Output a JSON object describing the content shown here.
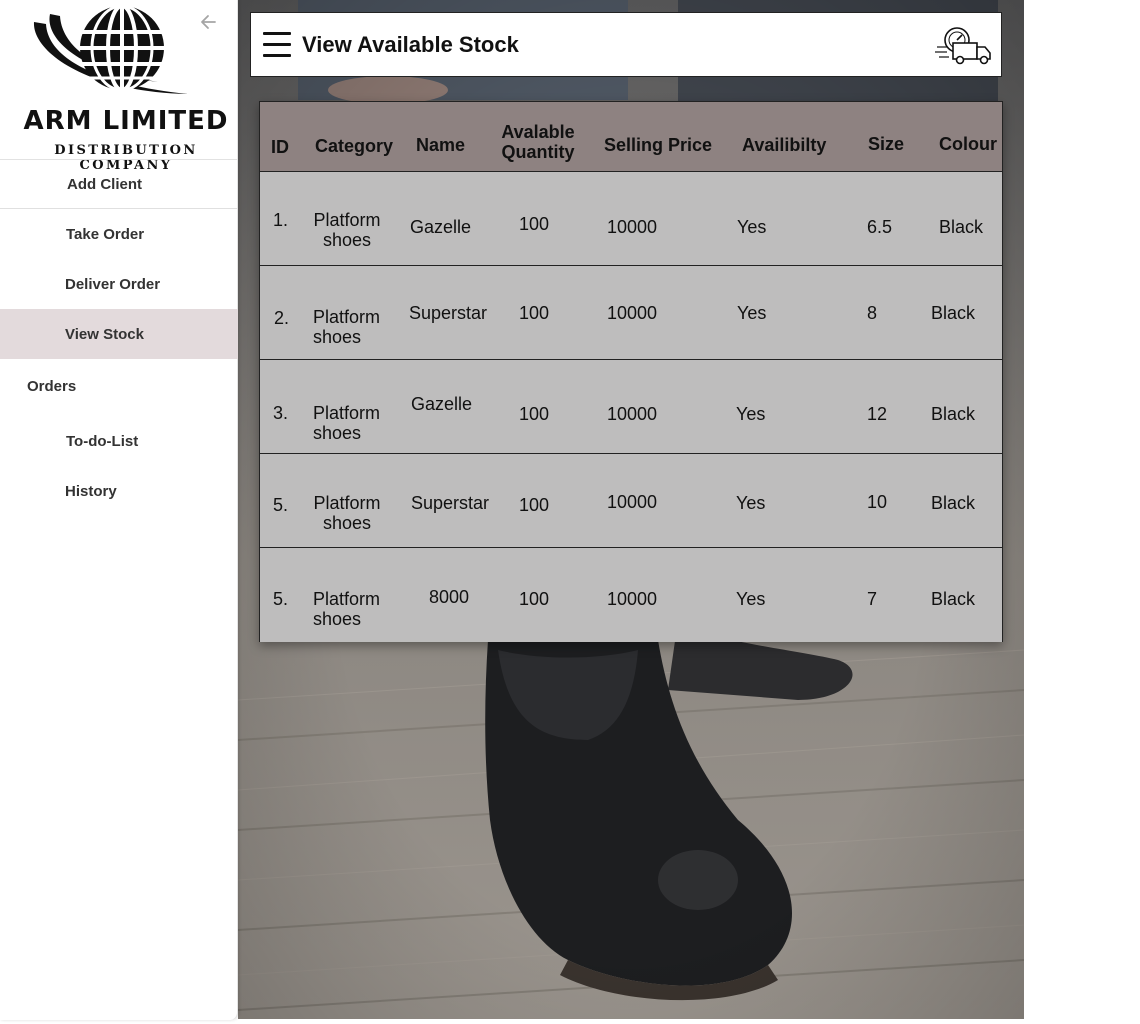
{
  "brand": {
    "title": "ARM LIMITED",
    "subtitle": "DISTRIBUTION COMPANY"
  },
  "sidebar": {
    "items": [
      {
        "label": "Add Client"
      },
      {
        "label": "Take Order"
      },
      {
        "label": "Deliver Order"
      },
      {
        "label": "View Stock",
        "active": true
      }
    ],
    "section": "Orders",
    "section_items": [
      {
        "label": "To-do-List"
      },
      {
        "label": "History"
      }
    ]
  },
  "header": {
    "title": "View Available Stock",
    "menu_icon": "hamburger-menu-icon",
    "delivery_icon": "delivery-truck-icon"
  },
  "table": {
    "columns": [
      "ID",
      "Category",
      "Name",
      "Avalable Quantity",
      "Selling Price",
      "Availibilty",
      "Size",
      "Colour"
    ],
    "rows": [
      {
        "id": "1.",
        "category": "Platform shoes",
        "name": "Gazelle",
        "quantity": "100",
        "price": "10000",
        "availability": "Yes",
        "size": "6.5",
        "colour": "Black"
      },
      {
        "id": "2.",
        "category": "Platform shoes",
        "name": "Superstar",
        "quantity": "100",
        "price": "10000",
        "availability": "Yes",
        "size": "8",
        "colour": "Black"
      },
      {
        "id": "3.",
        "category": "Platform shoes",
        "name": "Gazelle",
        "quantity": "100",
        "price": "10000",
        "availability": "Yes",
        "size": "12",
        "colour": "Black"
      },
      {
        "id": "5.",
        "category": "Platform shoes",
        "name": "Superstar",
        "quantity": "100",
        "price": "10000",
        "availability": "Yes",
        "size": "10",
        "colour": "Black"
      },
      {
        "id": "5.",
        "category": "Platform shoes",
        "name": "8000",
        "quantity": "100",
        "price": "10000",
        "availability": "Yes",
        "size": "7",
        "colour": "Black"
      }
    ]
  },
  "colors": {
    "header_row": "#8e8281",
    "body_row": "#bebdbd",
    "active_nav": "#e3dadc"
  }
}
